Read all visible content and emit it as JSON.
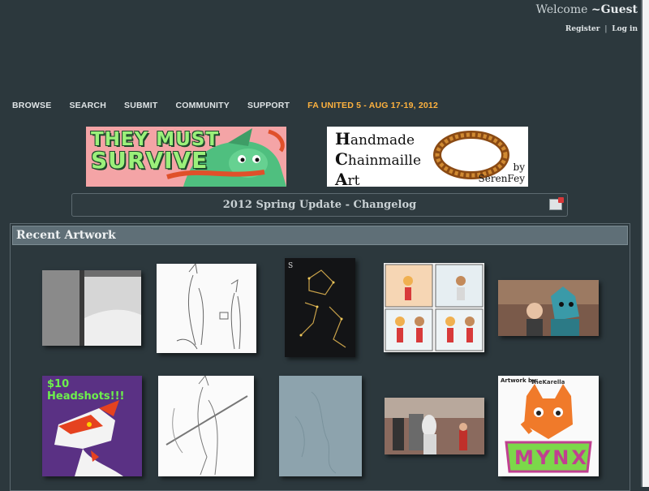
{
  "header": {
    "welcome_text": "Welcome",
    "user_name": "~Guest",
    "register_label": "Register",
    "separator": "|",
    "login_label": "Log in"
  },
  "nav": {
    "items": [
      "BROWSE",
      "SEARCH",
      "SUBMIT",
      "COMMUNITY",
      "SUPPORT"
    ],
    "promo": "FA UNITED 5 - AUG 17-19, 2012"
  },
  "banners": {
    "left": {
      "line1": "THEY MUST",
      "line2": "SURVIVE"
    },
    "right": {
      "line1_cap": "H",
      "line1": "andmade",
      "line2_cap": "C",
      "line2": "hainmaille",
      "line3_cap": "A",
      "line3": "rt",
      "by": "by",
      "author": "SerenFey"
    }
  },
  "update": {
    "title": "2012 Spring Update - Changelog"
  },
  "recent": {
    "title": "Recent Artwork",
    "thumbs": [
      {
        "name": "snowy-doorway",
        "badge": ""
      },
      {
        "name": "two-characters-sketch",
        "badge": ""
      },
      {
        "name": "constellation-dark",
        "badge": ""
      },
      {
        "name": "comic-strip",
        "badge": ""
      },
      {
        "name": "fursuit-photo",
        "badge": ""
      },
      {
        "name": "headshots-ad",
        "badge": "$10 Headshots!!!"
      },
      {
        "name": "sword-sketch",
        "badge": ""
      },
      {
        "name": "blue-sketch",
        "badge": ""
      },
      {
        "name": "street-fursuits",
        "badge": ""
      },
      {
        "name": "mynx-badge",
        "badge_top": "Artwork by:",
        "badge_artist": "TheKarella",
        "badge_name": "MYNX"
      }
    ]
  },
  "colors": {
    "background": "#2c383d",
    "panel_header": "#5f6f77",
    "promo": "#ffb23e"
  }
}
